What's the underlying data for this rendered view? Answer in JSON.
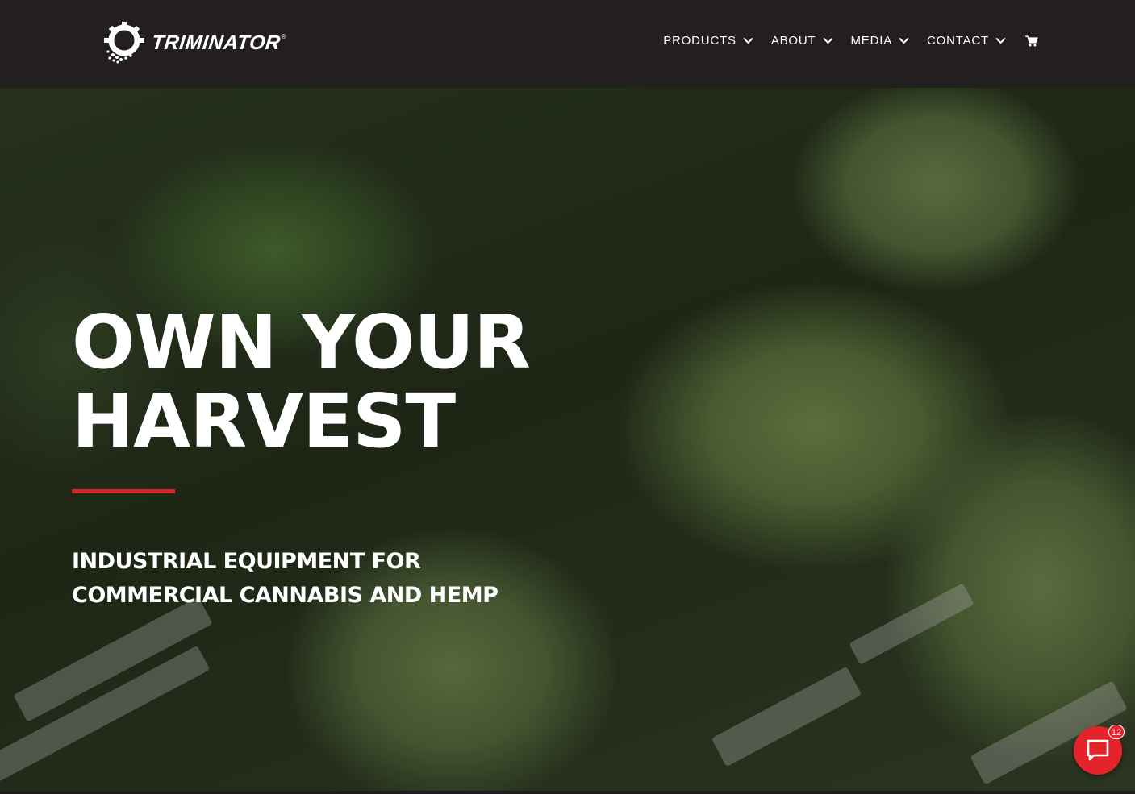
{
  "header": {
    "logo_text": "TRIMINATOR",
    "logo_reg": "®",
    "nav": [
      {
        "label": "PRODUCTS",
        "icon": "chevron-down-icon"
      },
      {
        "label": "ABOUT",
        "icon": "chevron-down-icon"
      },
      {
        "label": "MEDIA",
        "icon": "chevron-down-icon"
      },
      {
        "label": "CONTACT",
        "icon": "chevron-down-icon"
      }
    ],
    "cart_icon": "cart-icon"
  },
  "hero": {
    "headline_line1": "OWN YOUR",
    "headline_line2": "HARVEST",
    "subheading": "INDUSTRIAL EQUIPMENT FOR COMMERCIAL CANNABIS AND HEMP"
  },
  "chat": {
    "icon": "chat-icon",
    "badge_count": "12"
  },
  "colors": {
    "header_bg": "#231f20",
    "accent_red": "#d2262a",
    "chat_red": "#e4242a",
    "text": "#ffffff"
  }
}
